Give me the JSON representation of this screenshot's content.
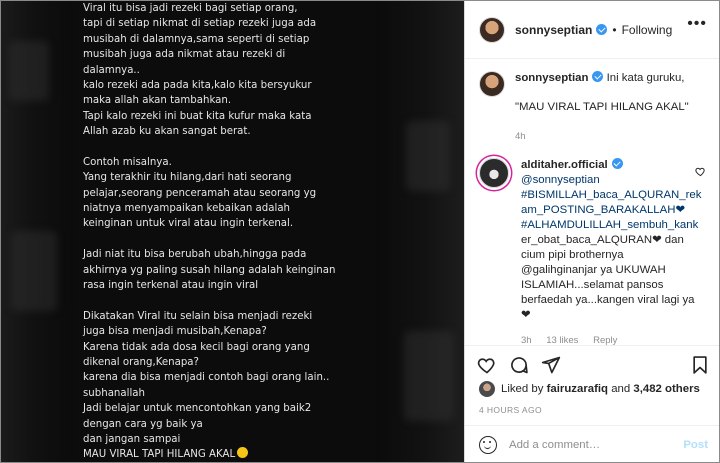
{
  "post_image": {
    "lines": [
      "Viral itu bisa jadi rezeki bagi setiap orang,",
      "tapi di setiap nikmat di setiap rezeki juga ada",
      "musibah di dalamnya,sama seperti di setiap",
      "musibah juga ada nikmat atau rezeki di",
      "dalamnya..",
      "kalo rezeki ada pada kita,kalo kita bersyukur",
      "maka allah akan tambahkan.",
      "Tapi kalo rezeki ini buat kita kufur maka kata",
      "Allah azab ku akan sangat berat.",
      "",
      "Contoh misalnya.",
      "Yang terakhir itu hilang,dari hati seorang",
      "pelajar,seorang penceramah atau seorang yg",
      "niatnya menyampaikan kebaikan adalah",
      "keinginan untuk viral atau ingin terkenal.",
      "",
      "Jadi niat itu bisa berubah ubah,hingga pada",
      "akhirnya yg paling susah hilang adalah keinginan",
      "rasa ingin terkenal atau ingin viral",
      "",
      "Dikatakan Viral itu selain bisa menjadi rezeki",
      "juga bisa menjadi musibah,Kenapa?",
      "Karena tidak ada dosa kecil bagi orang yang",
      "dikenal orang,Kenapa?",
      "karena dia bisa menjadi contoh bagi orang lain..",
      "subhanallah",
      "Jadi belajar untuk mencontohkan yang baik2",
      "dengan cara yg baik ya",
      "dan jangan sampai",
      "MAU VIRAL TAPI HILANG AKAL"
    ],
    "emoji": "smiling-face-emoji"
  },
  "header": {
    "username": "sonnyseptian",
    "separator": "•",
    "follow_status": "Following",
    "more": "•••"
  },
  "caption": {
    "username": "sonnyseptian",
    "line1": "Ini kata guruku,",
    "line2": "\"MAU VIRAL TAPI HILANG AKAL\"",
    "time": "4h"
  },
  "comment": {
    "username": "alditaher.official",
    "lines": [
      "@sonnyseptian",
      "#BISMILLAH_baca_ALQURAN_rek",
      "am_POSTING_BARAKALLAH❤",
      "#ALHAMDULILLAH_sembuh_kank",
      "er_obat_baca_ALQURAN❤ dan",
      "cium pipi brothernya",
      "@galihginanjar ya UKUWAH",
      "ISLAMIAH...selamat pansos",
      "berfaedah ya...kangen viral lagi ya",
      "❤"
    ],
    "time": "3h",
    "likes": "13 likes",
    "reply": "Reply"
  },
  "likes": {
    "prefix": "Liked by",
    "user": "fairuzarafiq",
    "joiner": "and",
    "count": "3,482 others"
  },
  "timestamp": "4 HOURS AGO",
  "add_comment": {
    "placeholder": "Add a comment…",
    "post_label": "Post"
  },
  "icons": {
    "like": "heart-icon",
    "comment": "comment-icon",
    "share": "paper-plane-icon",
    "save": "bookmark-icon",
    "emoji": "smiley-icon"
  },
  "colors": {
    "verified": "#3897f0",
    "link": "#00376b",
    "secondary": "#8e8e8e",
    "post_disabled": "#b2dffc"
  }
}
